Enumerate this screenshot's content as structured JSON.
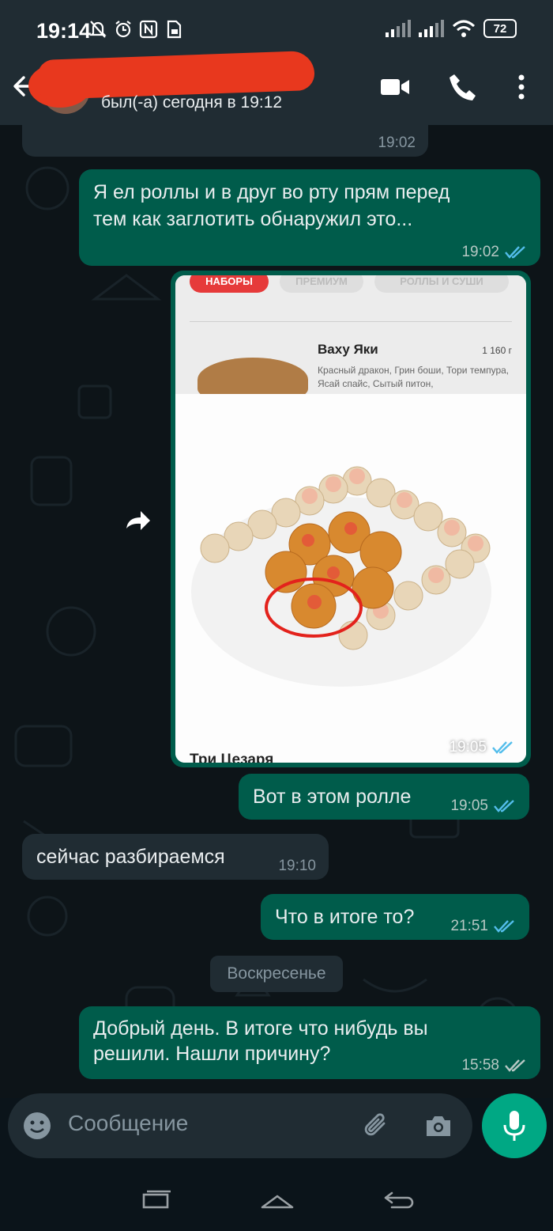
{
  "status_bar": {
    "time": "19:14",
    "battery": "72"
  },
  "header": {
    "last_seen": "был(-а) сегодня в 19:12"
  },
  "messages": [
    {
      "id": "m0",
      "direction": "in",
      "time": "19:02"
    },
    {
      "id": "m1",
      "direction": "out",
      "text_line1": "Я ел роллы и в друг во рту прям перед",
      "text_line2": "тем как заглотить обнаружил это...",
      "time": "19:02",
      "read": true
    },
    {
      "id": "m2",
      "direction": "out",
      "type": "image",
      "time": "19:05",
      "read": true,
      "image_content": {
        "tabs": [
          "НАБОРЫ",
          "ПРЕМИУМ",
          "РОЛЛЫ И СУШИ"
        ],
        "product_name": "Ваху Яки",
        "product_weight": "1 160 г",
        "product_desc": "Красный дракон, Грин боши, Тори темпура, Ясай спайс, Сытый питон,",
        "bottom_title": "Три Цезаря"
      }
    },
    {
      "id": "m3",
      "direction": "out",
      "text": "Вот в этом ролле",
      "time": "19:05",
      "read": true
    },
    {
      "id": "m4",
      "direction": "in",
      "text": "сейчас разбираемся",
      "time": "19:10"
    },
    {
      "id": "m5",
      "direction": "out",
      "text": "Что в итоге то?",
      "time": "21:51",
      "read": true
    },
    {
      "id": "m6",
      "direction": "out",
      "text_line1": "Добрый день. В итоге что нибудь вы",
      "text_line2": "решили. Нашли причину?",
      "time": "15:58",
      "read": false
    }
  ],
  "date_separator": "Воскресенье",
  "composer": {
    "placeholder": "Сообщение"
  },
  "colors": {
    "header": "#202c33",
    "outgoing": "#005c4b",
    "incoming": "#202c33",
    "accent": "#00a884",
    "read_ticks": "#53bdeb"
  }
}
